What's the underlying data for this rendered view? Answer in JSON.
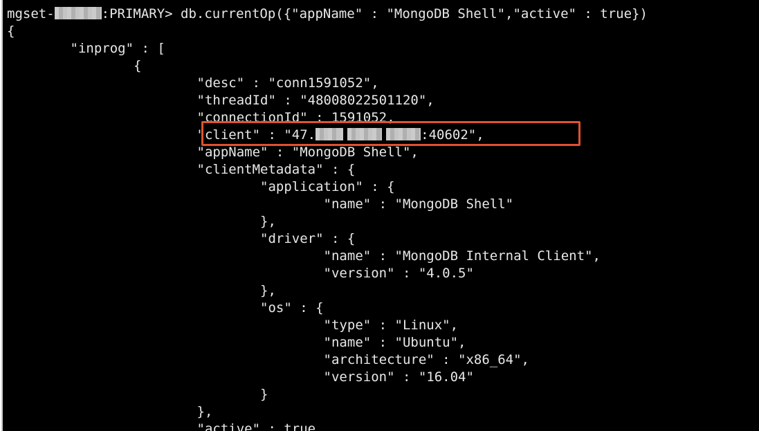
{
  "prompt": {
    "prefix": "mgset-",
    "suffix": ":PRIMARY>",
    "command": " db.currentOp({\"appName\" : \"MongoDB Shell\",\"active\" : true})"
  },
  "output_lines": [
    "{",
    "        \"inprog\" : [",
    "                {",
    "                        \"desc\" : \"conn1591052\",",
    "                        \"threadId\" : \"48008022501120\",",
    "                        \"connectionId\" : 1591052,",
    "                        \"client\" : \"47.",
    "                        \"appName\" : \"MongoDB Shell\",",
    "                        \"clientMetadata\" : {",
    "                                \"application\" : {",
    "                                        \"name\" : \"MongoDB Shell\"",
    "                                },",
    "                                \"driver\" : {",
    "                                        \"name\" : \"MongoDB Internal Client\",",
    "                                        \"version\" : \"4.0.5\"",
    "                                },",
    "                                \"os\" : {",
    "                                        \"type\" : \"Linux\",",
    "                                        \"name\" : \"Ubuntu\",",
    "                                        \"architecture\" : \"x86_64\",",
    "                                        \"version\" : \"16.04\"",
    "                                }",
    "                        },",
    "                        \"active\" : true,"
  ],
  "client_line_tail": ":40602\",",
  "highlight": {
    "color": "#e0522f",
    "target": "client"
  },
  "colors": {
    "terminal_bg": "#000000",
    "text": "#e8e8e8"
  }
}
